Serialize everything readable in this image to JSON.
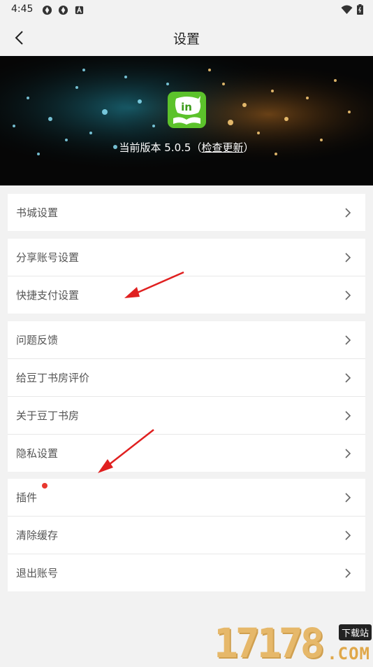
{
  "status_bar": {
    "time": "4:45"
  },
  "header": {
    "title": "设置",
    "back_icon": "chevron-left-icon"
  },
  "banner": {
    "version_text": "当前版本 5.0.5（",
    "check_update": "检查更新",
    "version_close": "）",
    "logo_text": "in"
  },
  "groups": [
    {
      "items": [
        {
          "label": "书城设置"
        }
      ]
    },
    {
      "items": [
        {
          "label": "分享账号设置"
        },
        {
          "label": "快捷支付设置"
        }
      ]
    },
    {
      "items": [
        {
          "label": "问题反馈"
        },
        {
          "label": "给豆丁书房评价"
        },
        {
          "label": "关于豆丁书房"
        },
        {
          "label": "隐私设置"
        }
      ]
    },
    {
      "items": [
        {
          "label": "插件",
          "badge": true
        },
        {
          "label": "清除缓存"
        },
        {
          "label": "退出账号"
        }
      ]
    }
  ],
  "watermark": {
    "number": "17178",
    "tag": "下载站",
    "domain": ".COM"
  },
  "colors": {
    "background": "#f2f2f2",
    "badge": "#e8382f",
    "annotation_arrow": "#e02020",
    "logo_green": "#5cc22b"
  }
}
